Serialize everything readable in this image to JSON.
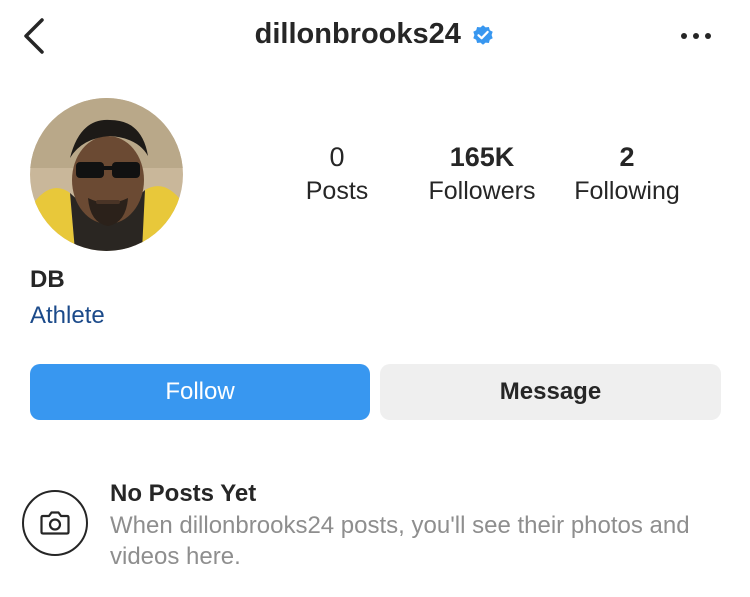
{
  "header": {
    "username": "dillonbrooks24",
    "back_icon": "chevron-left-icon",
    "verified_icon": "verified-badge-icon",
    "more_icon": "more-horizontal-icon",
    "verified_color": "#3897f0"
  },
  "profile": {
    "avatar_icon": "profile-avatar",
    "display_name": "DB",
    "category": "Athlete",
    "category_color": "#1b4a8a"
  },
  "stats": [
    {
      "value": "0",
      "label": "Posts"
    },
    {
      "value": "165K",
      "label": "Followers"
    },
    {
      "value": "2",
      "label": "Following"
    }
  ],
  "actions": {
    "follow_label": "Follow",
    "message_label": "Message",
    "follow_color": "#3897f0"
  },
  "empty_state": {
    "icon": "camera-icon",
    "title": "No Posts Yet",
    "description": "When dillonbrooks24 posts, you'll see their photos and videos here."
  }
}
